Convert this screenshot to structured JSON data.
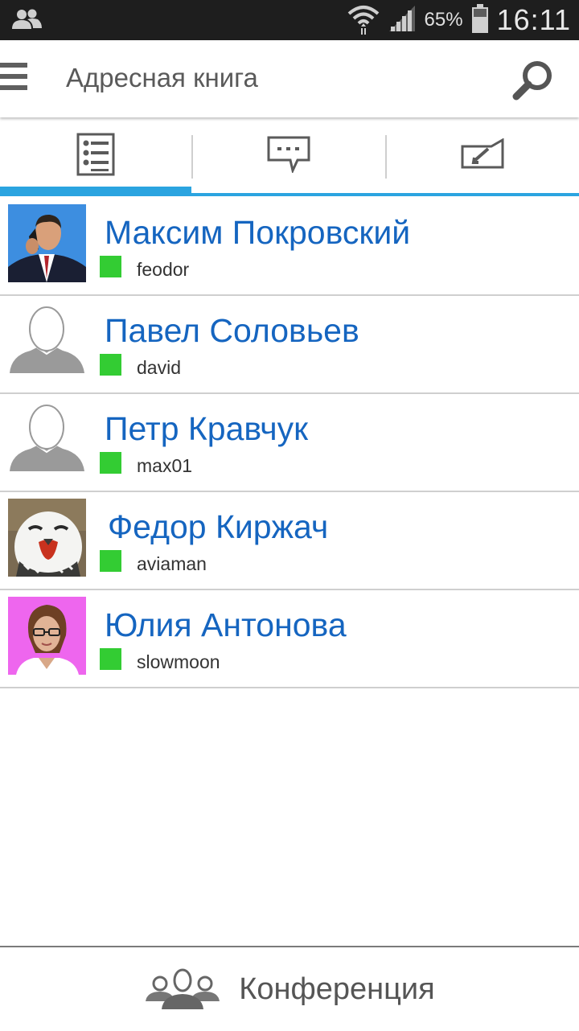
{
  "status_bar": {
    "left_icon": "contacts-notification-icon",
    "wifi_icon": "wifi-icon",
    "signal_icon": "signal-icon",
    "battery_percent": "65%",
    "battery_icon": "battery-icon",
    "time": "16:11"
  },
  "app_bar": {
    "menu_icon": "hamburger-menu-icon",
    "title": "Адресная книга",
    "search_icon": "search-icon"
  },
  "tabs": [
    {
      "icon": "contact-list-icon",
      "selected": true
    },
    {
      "icon": "chat-bubble-icon",
      "selected": false
    },
    {
      "icon": "call-history-icon",
      "selected": false
    }
  ],
  "contacts": [
    {
      "name": "Максим Покровский",
      "login": "feodor",
      "status": "online",
      "avatar": "photo-businessman-phone"
    },
    {
      "name": "Павел Соловьев",
      "login": "david",
      "status": "online",
      "avatar": "default-avatar"
    },
    {
      "name": "Петр Кравчук",
      "login": "max01",
      "status": "online",
      "avatar": "default-avatar"
    },
    {
      "name": "Федор Киржач",
      "login": "aviaman",
      "status": "online",
      "avatar": "photo-owl"
    },
    {
      "name": "Юлия Антонова",
      "login": "slowmoon",
      "status": "online",
      "avatar": "photo-woman-glasses"
    }
  ],
  "bottom_bar": {
    "icon": "conference-group-icon",
    "label": "Конференция"
  },
  "colors": {
    "accent": "#2ba4e0",
    "name_text": "#1565c0",
    "online_status": "#33cc33",
    "status_bar_bg": "#1e1e1e"
  }
}
